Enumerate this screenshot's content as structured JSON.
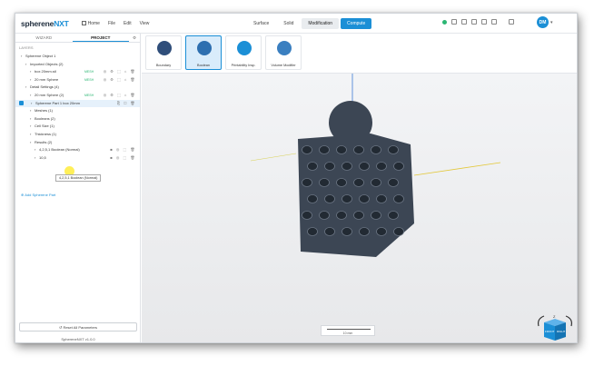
{
  "app": {
    "brand": "sphereneNXT",
    "version": "SphereneNXT v1.0.0"
  },
  "menu": {
    "items": [
      "Home",
      "File",
      "Edit",
      "View"
    ]
  },
  "modes": {
    "surface": "Surface",
    "solid": "Solid",
    "modification": "Modification",
    "compute": "Compute"
  },
  "user": {
    "initials": "DM"
  },
  "left_panel": {
    "tabs": {
      "wizard": "WIZARD",
      "project": "PROJECT"
    },
    "layers_label": "LAYERS",
    "tree": [
      {
        "text": "Spherene Object 1",
        "indent": 0,
        "selected": false,
        "badge": "",
        "acts": ""
      },
      {
        "text": "Imported Objects (2)",
        "indent": 1,
        "selected": false,
        "badge": "",
        "acts": ""
      },
      {
        "text": "box 20mm.stl",
        "indent": 2,
        "selected": false,
        "badge": "MESH",
        "acts": "◎ ⚙ ⬚ ⌂ 🗑"
      },
      {
        "text": "20 mm Sphere",
        "indent": 2,
        "selected": false,
        "badge": "MESH",
        "acts": "◎ ⚙ ⬚ ⌂ 🗑"
      },
      {
        "text": "Detail Settings (4)",
        "indent": 1,
        "selected": false,
        "badge": "",
        "acts": ""
      },
      {
        "text": "20 mm Sphere (2)",
        "indent": 2,
        "selected": false,
        "badge": "MESH",
        "acts": "◎ ⚙ ⬚ ⌂ 🗑"
      },
      {
        "text": "Spherene Part 1 box 20mm",
        "indent": 1,
        "selected": true,
        "badge": "",
        "acts": "⎘ ⬚ 🗑"
      },
      {
        "text": "Meshes (1)",
        "indent": 2,
        "selected": false,
        "badge": "",
        "acts": ""
      },
      {
        "text": "Booleans (2)",
        "indent": 2,
        "selected": false,
        "badge": "",
        "acts": ""
      },
      {
        "text": "Cell Size (1)",
        "indent": 2,
        "selected": false,
        "badge": "",
        "acts": ""
      },
      {
        "text": "Thickness (1)",
        "indent": 2,
        "selected": false,
        "badge": "",
        "acts": ""
      },
      {
        "text": "Results (2)",
        "indent": 2,
        "selected": false,
        "badge": "",
        "acts": ""
      },
      {
        "text": "4,2,5,1 Boolean (Normal)",
        "indent": 3,
        "selected": false,
        "badge": "",
        "acts": "■ ◎ ⬚ 🗑"
      },
      {
        "text": "10,5",
        "indent": 3,
        "selected": false,
        "badge": "",
        "acts": "■ ◎ ⬚ 🗑"
      }
    ],
    "tooltip": "4,2,5,1 Boolean (Normal)",
    "add_part": "Add Spherene Part",
    "reset_label": "Reset All Parameters"
  },
  "tools": [
    {
      "label": "Boundary",
      "color": "#2f4e7a"
    },
    {
      "label": "Boolean",
      "color": "#2d6fb0"
    },
    {
      "label": "Printability Insp.",
      "color": "#1b8fd6"
    },
    {
      "label": "Volume Modifier",
      "color": "#3a7fc0"
    }
  ],
  "viewport": {
    "scale_value": "10 mm",
    "cube": {
      "top_face": "Z",
      "front_face": "FRONT",
      "side_face": "RIGHT",
      "accent": "#1b8fd6"
    },
    "object_color": "#3c4654"
  }
}
